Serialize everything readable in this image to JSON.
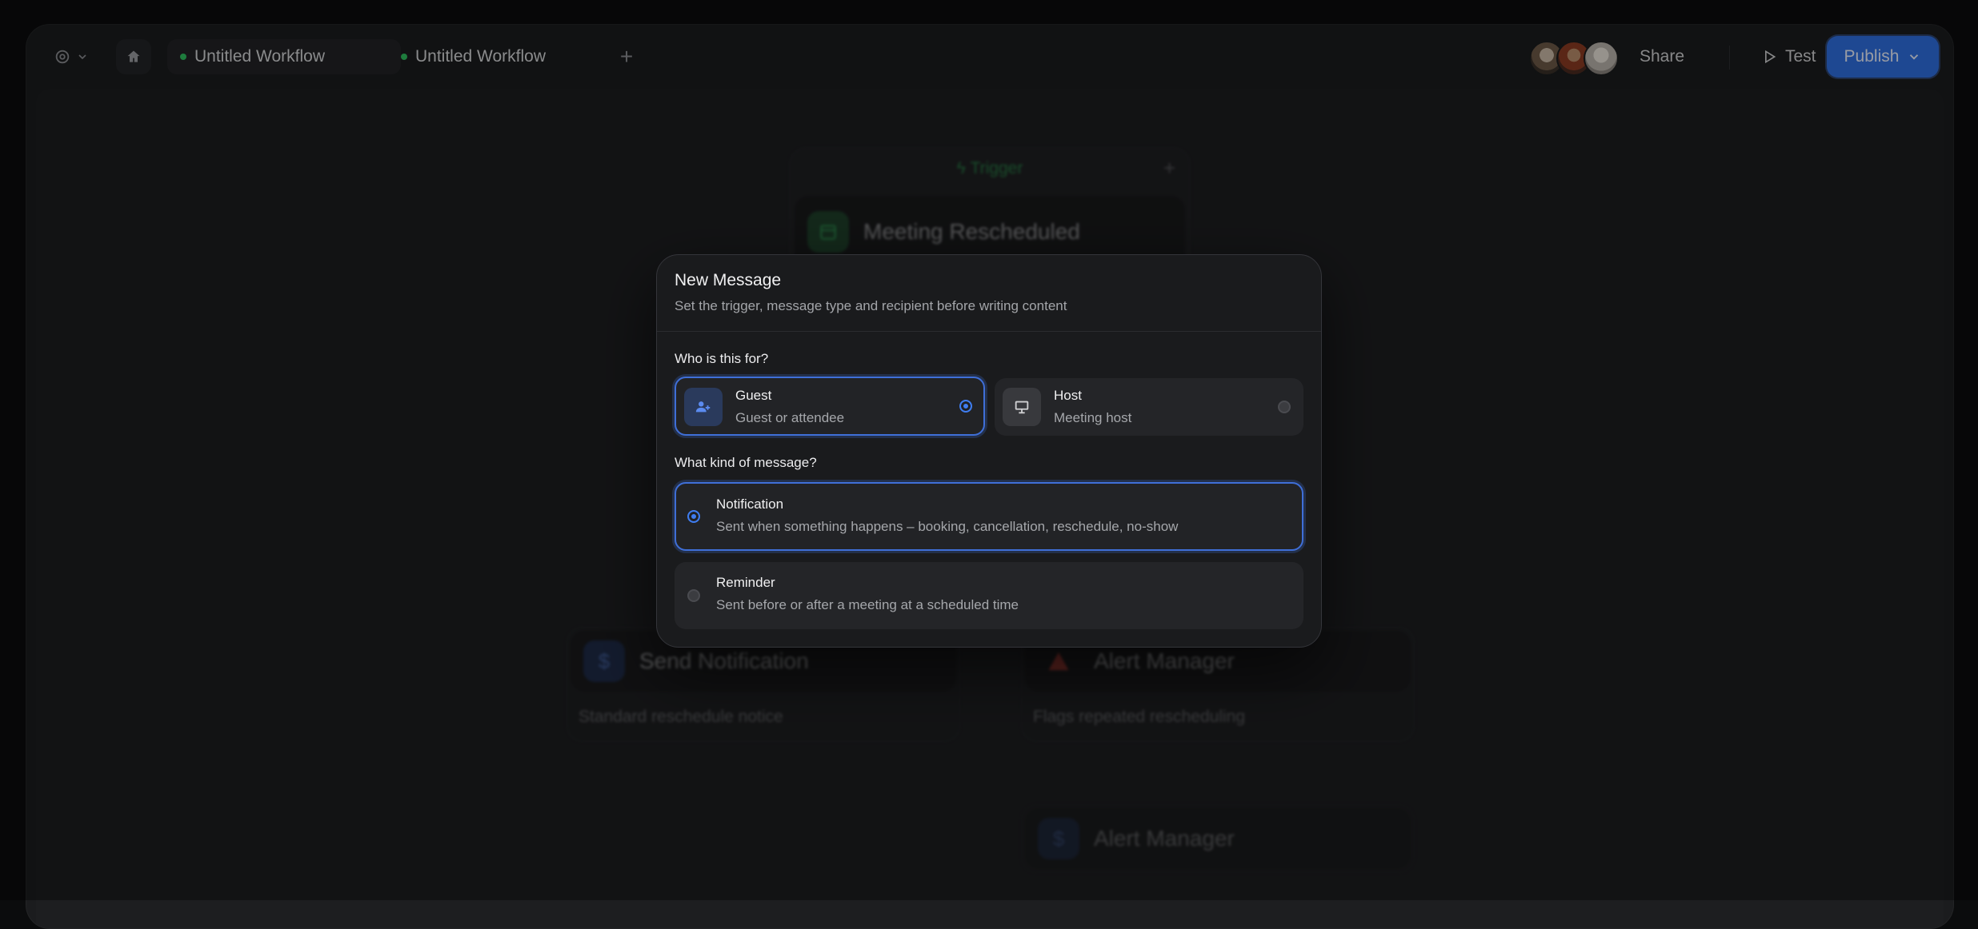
{
  "toolbar": {
    "tabs": [
      {
        "label": "Untitled Workflow",
        "status": "active"
      },
      {
        "label": "Untitled Workflow",
        "status": "active"
      }
    ],
    "share_label": "Share",
    "test_label": "Test",
    "publish_label": "Publish"
  },
  "canvas": {
    "trigger": {
      "label": "Trigger",
      "title": "Meeting Rescheduled"
    },
    "nodes": [
      {
        "title": "Send Notification",
        "desc": "Standard reschedule notice"
      },
      {
        "title": "Alert Manager",
        "desc": "Flags repeated rescheduling"
      },
      {
        "title": "Alert Manager",
        "desc": ""
      }
    ]
  },
  "dialog": {
    "title": "New Message",
    "subtitle": "Set the trigger, message type and recipient before writing content",
    "recipient_label": "Who is this for?",
    "recipients": [
      {
        "title": "Guest",
        "subtitle": "Guest or attendee",
        "selected": true,
        "icon": "user-plus-icon"
      },
      {
        "title": "Host",
        "subtitle": "Meeting host",
        "selected": false,
        "icon": "presentation-icon"
      }
    ],
    "type_label": "What kind of message?",
    "types": [
      {
        "title": "Notification",
        "subtitle": "Sent when something happens – booking, cancellation, reschedule, no-show",
        "selected": true
      },
      {
        "title": "Reminder",
        "subtitle": "Sent before or after a meeting at a scheduled time",
        "selected": false
      }
    ]
  },
  "colors": {
    "accent": "#3f7df0",
    "publish": "#2f6fe0",
    "trigger": "#2fbf5f",
    "alert": "#e0453a"
  }
}
